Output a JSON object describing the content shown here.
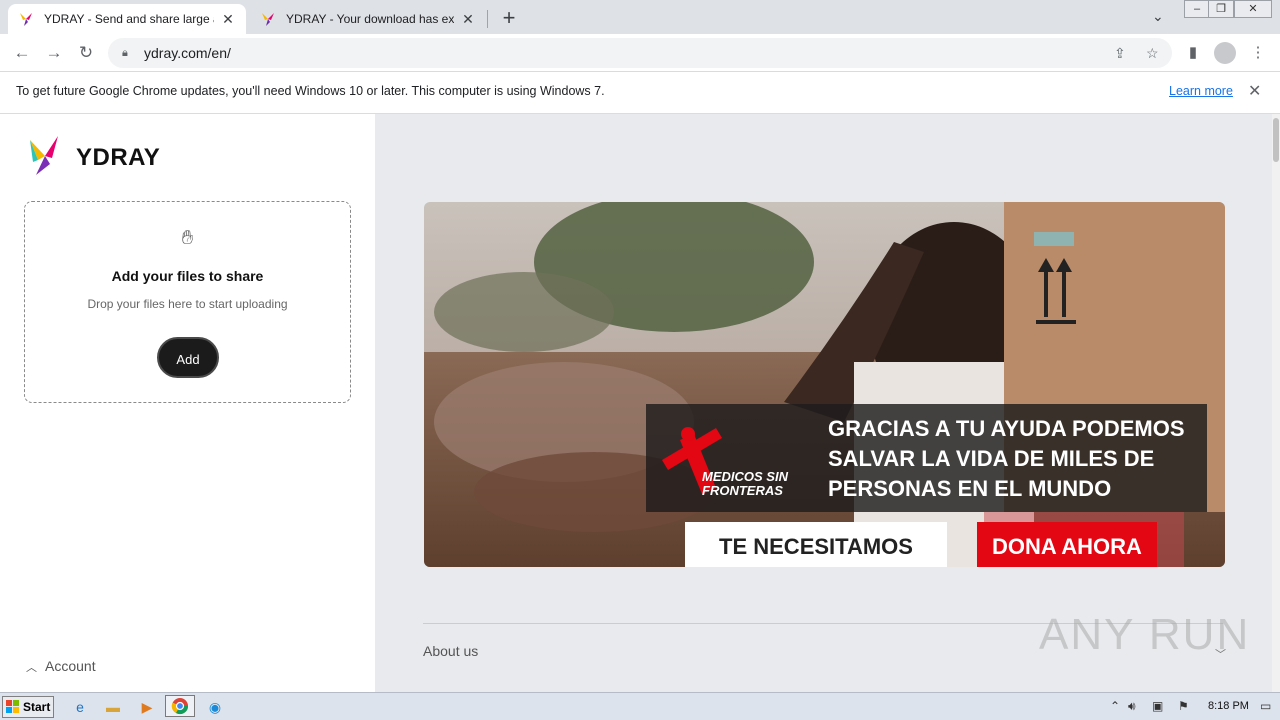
{
  "browser": {
    "tabs": [
      {
        "title": "YDRAY - Send and share large and b",
        "active": true
      },
      {
        "title": "YDRAY - Your download has expired",
        "active": false
      }
    ],
    "url": "ydray.com/en/",
    "infobar": {
      "message": "To get future Google Chrome updates, you'll need Windows 10 or later. This computer is using Windows 7.",
      "link": "Learn more"
    }
  },
  "page": {
    "brand": "YDRAY",
    "upload": {
      "title": "Add your files to share",
      "subtitle": "Drop your files here to start uploading",
      "button": "Add"
    },
    "account_label": "Account",
    "banner": {
      "org": "MEDICOS SIN FRONTERAS",
      "headline": "GRACIAS A TU AYUDA PODEMOS SALVAR LA VIDA DE MILES DE PERSONAS EN EL MUNDO",
      "primary_cta": "TE NECESITAMOS",
      "secondary_cta": "DONA AHORA"
    },
    "footer": {
      "about": "About us"
    },
    "watermark": "ANY RUN"
  },
  "taskbar": {
    "start_label": "Start",
    "clock": "8:18 PM"
  },
  "colors": {
    "brand_accent": "#e30613",
    "link": "#1a73e8",
    "right_panel_bg": "#e8eaed"
  }
}
